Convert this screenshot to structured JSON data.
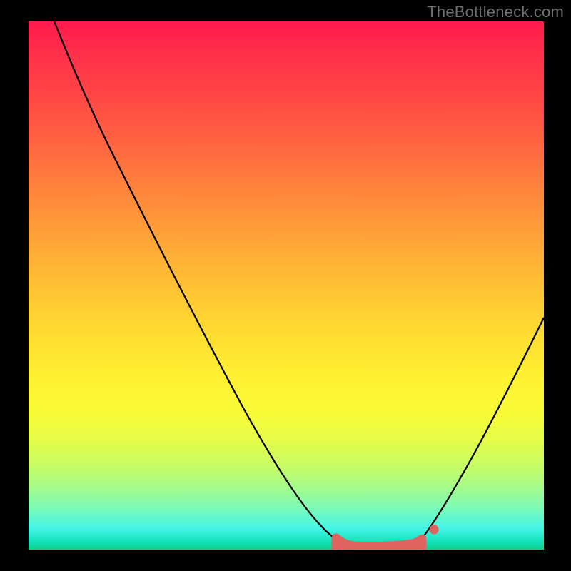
{
  "watermark": "TheBottleneck.com",
  "chart_data": {
    "type": "line",
    "title": "",
    "xlabel": "",
    "ylabel": "",
    "xlim": [
      0,
      100
    ],
    "ylim": [
      0,
      100
    ],
    "grid": false,
    "note": "No axis ticks or numeric labels are visible; x/y values are estimated in percent of plot width/height from the bottom-left.",
    "series": [
      {
        "name": "bottleneck-curve",
        "color": "#000000",
        "x": [
          5,
          10,
          16,
          22,
          28,
          34,
          40,
          46,
          52,
          55,
          58,
          60,
          63,
          66,
          70,
          74,
          76,
          78,
          82,
          86,
          90,
          94,
          98
        ],
        "y": [
          100,
          90,
          79,
          68,
          58,
          48,
          38,
          28,
          18,
          12,
          7,
          4,
          1.5,
          0.5,
          0.5,
          0.7,
          1.3,
          4,
          12,
          22,
          32,
          42,
          52
        ]
      },
      {
        "name": "highlight-band",
        "color": "#e0635f",
        "type": "area",
        "x": [
          60,
          62,
          64,
          66,
          68,
          70,
          72,
          74,
          76
        ],
        "y": [
          1.9,
          1.2,
          0.8,
          0.7,
          0.7,
          0.7,
          0.8,
          1.0,
          1.5
        ]
      },
      {
        "name": "highlight-dot",
        "color": "#e0635f",
        "type": "scatter",
        "x": [
          78.5
        ],
        "y": [
          3.7
        ]
      }
    ]
  }
}
